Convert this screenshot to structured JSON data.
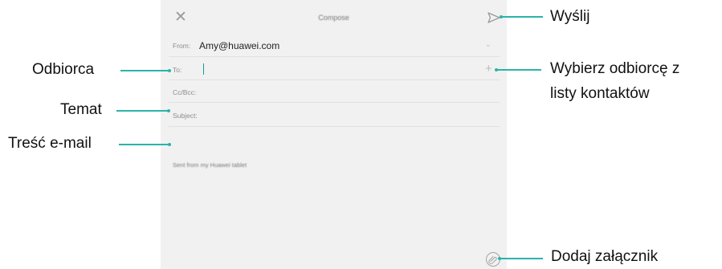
{
  "screen": {
    "title": "Compose",
    "from_label": "From:",
    "from_value": "Amy@huawei.com",
    "to_label": "To:",
    "ccbcc_label": "Cc/Bcc:",
    "subject_label": "Subject:",
    "body_signature": "Sent from my Huawei tablet"
  },
  "callouts": {
    "send": "Wyślij",
    "recipient": "Odbiorca",
    "pick_contact_line1": "Wybierz odbiorcę z",
    "pick_contact_line2": "listy kontaktów",
    "subject": "Temat",
    "body": "Treść e-mail",
    "attach": "Dodaj załącznik"
  },
  "colors": {
    "accent": "#2bb3ab",
    "screen_bg": "#f1f1f1"
  },
  "icons": [
    "close-icon",
    "send-icon",
    "chevron-down-icon",
    "plus-icon",
    "attachment-icon"
  ]
}
